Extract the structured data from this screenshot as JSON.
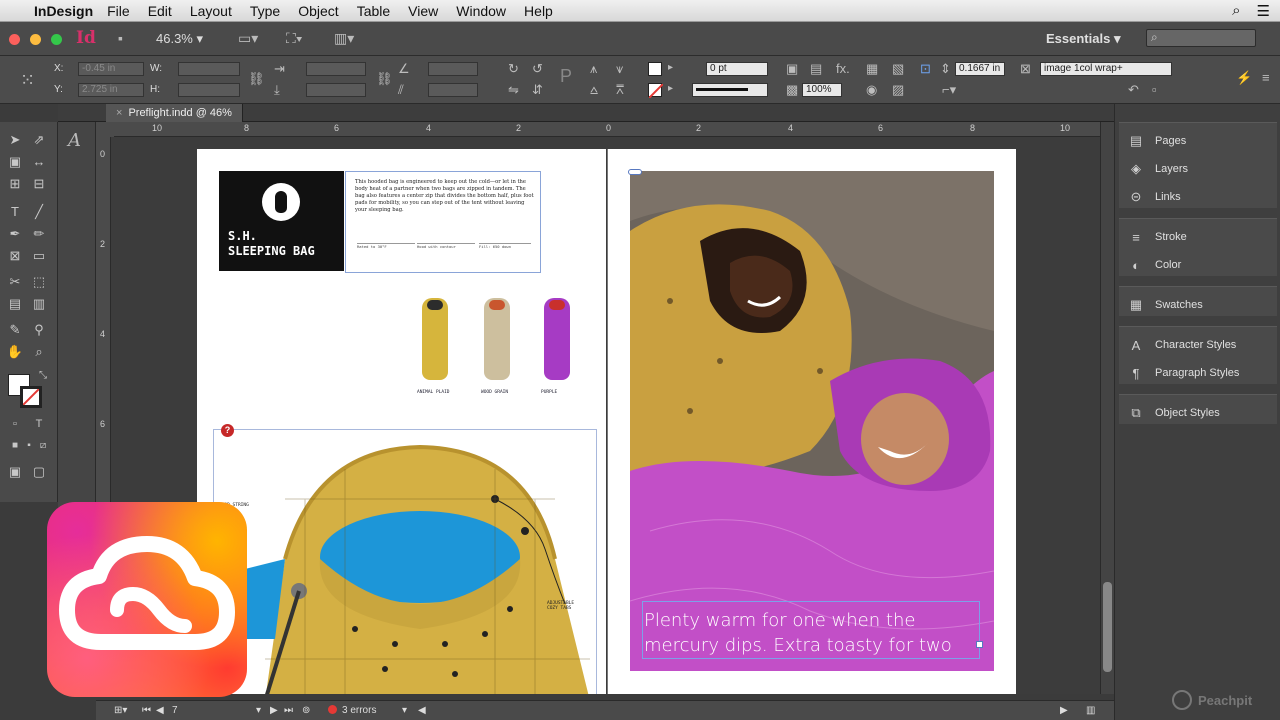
{
  "menubar": {
    "app": "InDesign",
    "items": [
      "File",
      "Edit",
      "Layout",
      "Type",
      "Object",
      "Table",
      "View",
      "Window",
      "Help"
    ]
  },
  "appbar": {
    "logo": "Id",
    "zoom": "46.3%",
    "workspace": "Essentials"
  },
  "control": {
    "x_label": "X:",
    "y_label": "Y:",
    "w_label": "W:",
    "h_label": "H:",
    "x_value": "-0.45 in",
    "y_value": "2.725 in",
    "stroke_weight": "0 pt",
    "opacity": "100%",
    "offset": "0.1667 in",
    "object_style": "image 1col wrap+"
  },
  "tab": {
    "title": "Preflight.indd @ 46%"
  },
  "ruler": {
    "h": [
      "10",
      "8",
      "6",
      "4",
      "2",
      "0",
      "2",
      "4",
      "6",
      "8",
      "10"
    ],
    "v": [
      "0",
      "2",
      "4",
      "6"
    ]
  },
  "left_page": {
    "product_title": "S.H.\nSLEEPING BAG",
    "description": "This hooded bag is engineered to keep out the cold—or let in the body heat of a partner when two bags are zipped in tandem. The bag also features a center zip that divides the bottom half, plus foot pads for mobility, so you can step out of the tent without leaving your sleeping bag.",
    "specs": [
      "Rated to 30°F",
      "Hood with contour",
      "Fill: 650 down"
    ],
    "thumb_captions": [
      "ANIMAL PLAID",
      "WOOD GRAIN",
      "PURPLE"
    ],
    "callout_left": "HOOD STRING",
    "callout_right": "ADJUSTABLE COZY TABS"
  },
  "right_page": {
    "caption": "Plenty warm for one when the mercury dips. Extra toasty for two"
  },
  "panels": [
    {
      "label": "Pages",
      "icon": "pages-icon"
    },
    {
      "label": "Layers",
      "icon": "layers-icon"
    },
    {
      "label": "Links",
      "icon": "links-icon"
    },
    {
      "label": "Stroke",
      "icon": "stroke-icon"
    },
    {
      "label": "Color",
      "icon": "color-icon"
    },
    {
      "label": "Swatches",
      "icon": "swatches-icon"
    },
    {
      "label": "Character Styles",
      "icon": "character-styles-icon"
    },
    {
      "label": "Paragraph Styles",
      "icon": "paragraph-styles-icon"
    },
    {
      "label": "Object Styles",
      "icon": "object-styles-icon"
    }
  ],
  "status": {
    "page": "7",
    "errors": "3 errors"
  },
  "watermark": "Peachpit",
  "colors": {
    "accent_error": "#e53935",
    "indesign_pink": "#d8306a",
    "frame_blue": "#7da0e8"
  }
}
